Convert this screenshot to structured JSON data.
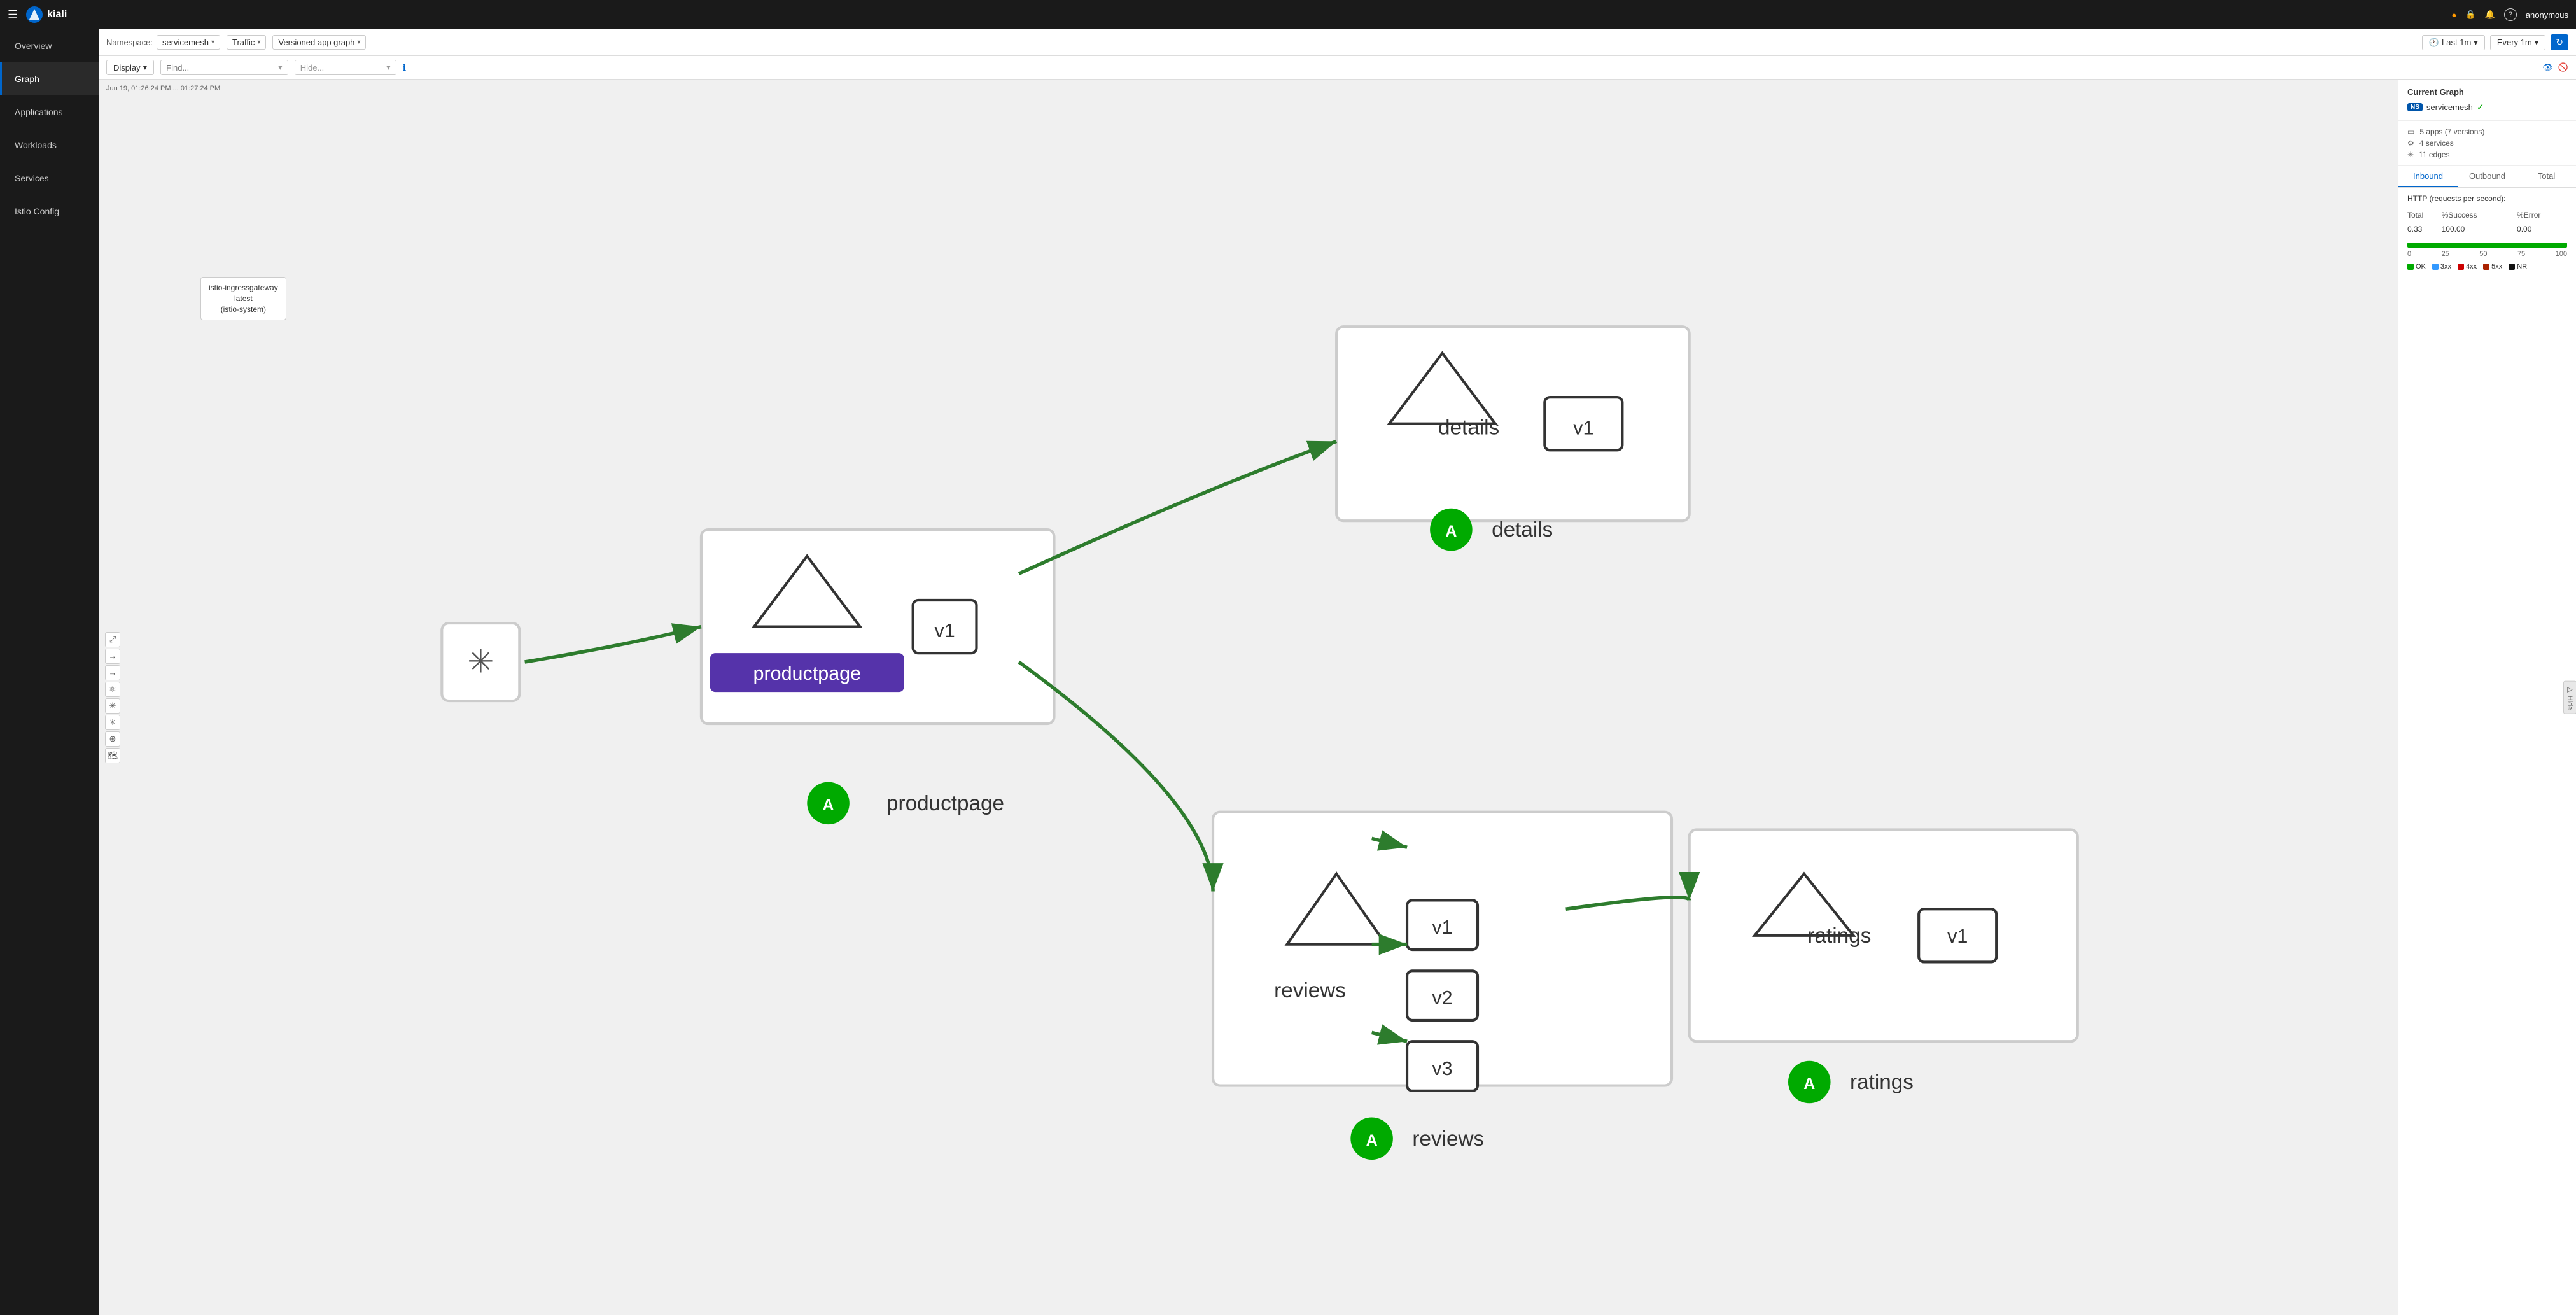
{
  "topnav": {
    "menu_icon": "☰",
    "brand": "kiali",
    "icons": {
      "warning": "⚠",
      "lock": "🔒",
      "bell": "🔔",
      "help": "?"
    },
    "user": "anonymous"
  },
  "sidebar": {
    "items": [
      {
        "id": "overview",
        "label": "Overview",
        "active": false
      },
      {
        "id": "graph",
        "label": "Graph",
        "active": true
      },
      {
        "id": "applications",
        "label": "Applications",
        "active": false
      },
      {
        "id": "workloads",
        "label": "Workloads",
        "active": false
      },
      {
        "id": "services",
        "label": "Services",
        "active": false
      },
      {
        "id": "istio-config",
        "label": "Istio Config",
        "active": false
      }
    ]
  },
  "toolbar": {
    "namespace_label": "Namespace:",
    "namespace_value": "servicemesh",
    "traffic_label": "Traffic",
    "graph_type": "Versioned app graph",
    "last_time": "Last 1m",
    "every_time": "Every 1m",
    "display_label": "Display",
    "find_placeholder": "Find...",
    "hide_placeholder": "Hide..."
  },
  "graph": {
    "timestamp": "Jun 19, 01:26:24 PM ... 01:27:24 PM",
    "tooltip": {
      "line1": "istio-ingressgateway",
      "line2": "latest",
      "line3": "(istio-system)"
    }
  },
  "right_panel": {
    "title": "Current Graph",
    "namespace": "servicemesh",
    "ns_badge": "NS",
    "stats": {
      "apps": "5 apps (7 versions)",
      "services": "4 services",
      "edges": "11 edges"
    },
    "tabs": [
      {
        "id": "inbound",
        "label": "Inbound",
        "active": true
      },
      {
        "id": "outbound",
        "label": "Outbound",
        "active": false
      },
      {
        "id": "total",
        "label": "Total",
        "active": false
      }
    ],
    "http_label": "HTTP (requests per second):",
    "table": {
      "headers": [
        "Total",
        "%Success",
        "%Error"
      ],
      "rows": [
        [
          "0.33",
          "100.00",
          "0.00"
        ]
      ]
    },
    "chart": {
      "bar_fill_percent": 100,
      "axis": [
        "0",
        "25",
        "50",
        "75",
        "100"
      ]
    },
    "legend": [
      {
        "label": "OK",
        "color": "#00aa00"
      },
      {
        "label": "3xx",
        "color": "#3399ff"
      },
      {
        "label": "4xx",
        "color": "#cc0000"
      },
      {
        "label": "5xx",
        "color": "#aa2200"
      },
      {
        "label": "NR",
        "color": "#111111"
      }
    ]
  }
}
